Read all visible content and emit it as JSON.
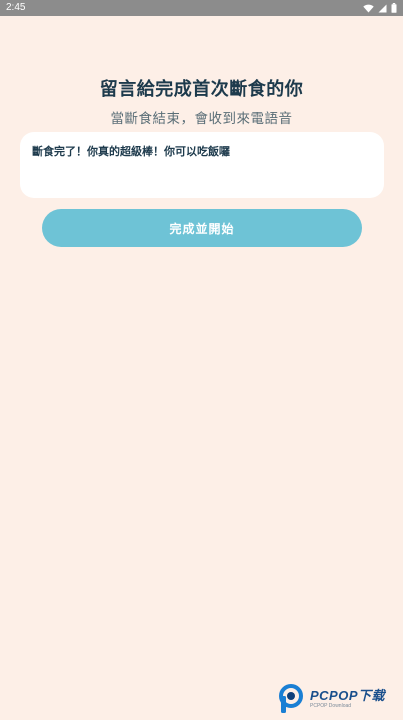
{
  "status_bar": {
    "time": "2:45",
    "icons": [
      "wifi-icon",
      "signal-icon",
      "battery-icon"
    ]
  },
  "page": {
    "title": "留言給完成首次斷食的你",
    "subtitle": "當斷食結束，會收到來電語音"
  },
  "message": {
    "value": "斷食完了！你真的超級棒！你可以吃飯囉"
  },
  "start_button": {
    "label": "完成並開始"
  },
  "watermark": {
    "brand": "PCPOP下载",
    "sub": "PCPOP Download"
  },
  "colors": {
    "background": "#fdefe7",
    "status_bar": "#8c8c8c",
    "title": "#1d3a4c",
    "subtitle": "#5a6e77",
    "button": "#6ec3d6",
    "message_box": "#ffffff"
  }
}
